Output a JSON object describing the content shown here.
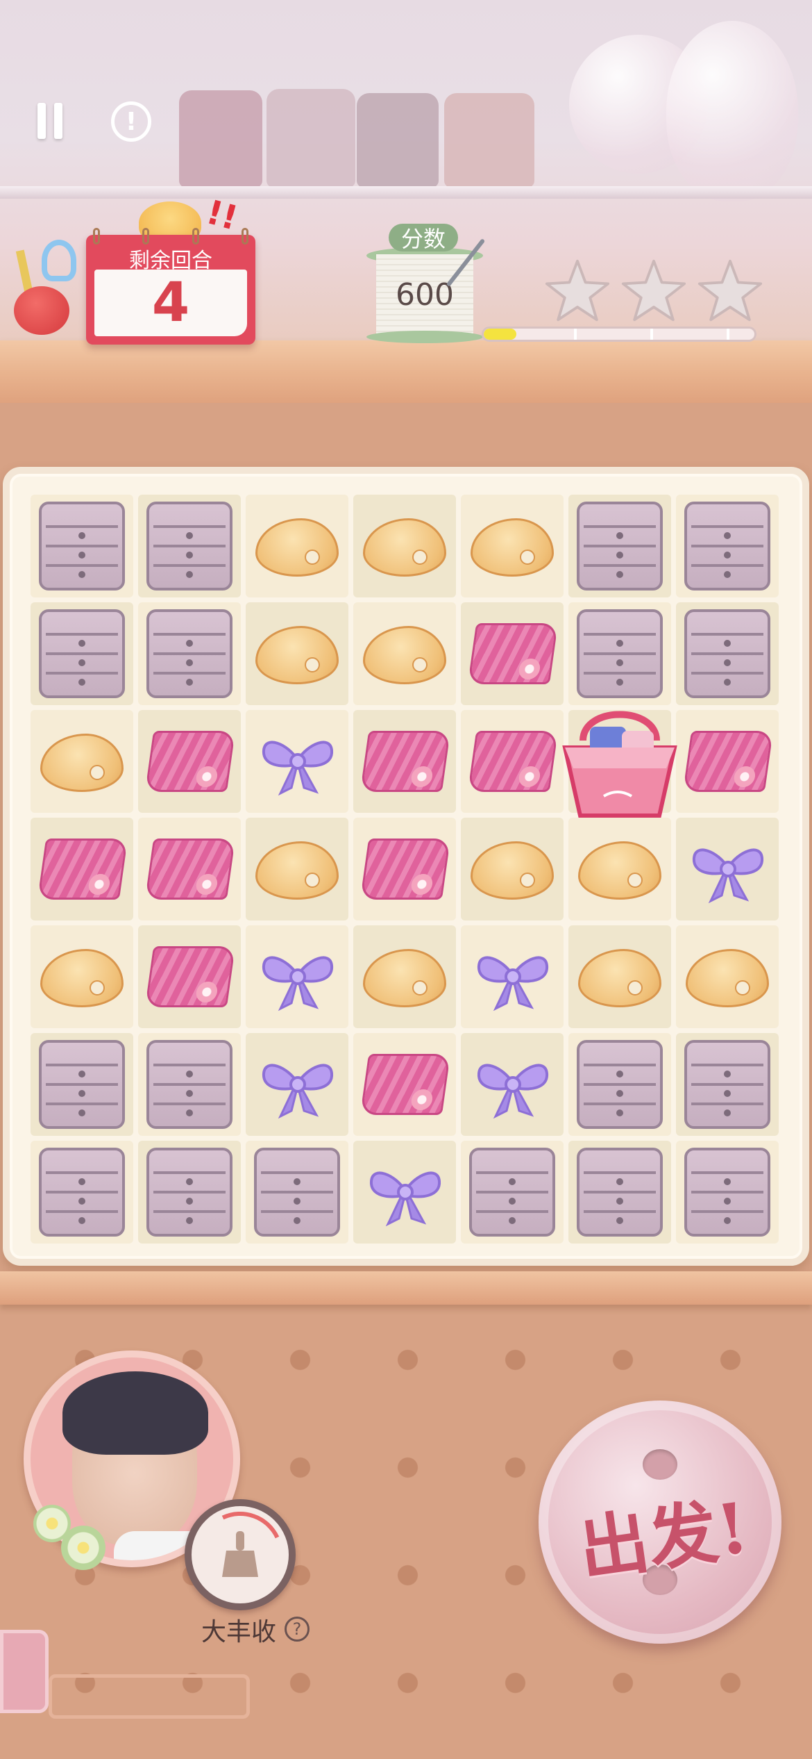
{
  "hud": {
    "turns_label": "剩余回合",
    "turns_value": "4",
    "score_label": "分数",
    "score_value": "600",
    "score_progress": 0.12,
    "stars_earned": 0,
    "stars_total": 3
  },
  "board": {
    "rows": 7,
    "cols": 7,
    "tiles": [
      [
        "drawer",
        "drawer",
        "palette",
        "palette",
        "palette",
        "drawer",
        "drawer"
      ],
      [
        "drawer",
        "drawer",
        "palette",
        "palette",
        "cloth",
        "drawer",
        "drawer"
      ],
      [
        "palette",
        "cloth",
        "bow",
        "cloth",
        "cloth",
        "basket",
        "cloth"
      ],
      [
        "cloth",
        "cloth",
        "palette",
        "cloth",
        "palette",
        "palette",
        "bow"
      ],
      [
        "palette",
        "cloth",
        "bow",
        "palette",
        "bow",
        "palette",
        "palette"
      ],
      [
        "drawer",
        "drawer",
        "bow",
        "cloth",
        "bow",
        "drawer",
        "drawer"
      ],
      [
        "drawer",
        "drawer",
        "drawer",
        "bow",
        "drawer",
        "drawer",
        "drawer"
      ]
    ]
  },
  "skill": {
    "name": "大丰收",
    "help": "?"
  },
  "go_button": {
    "label": "出发!"
  },
  "colors": {
    "accent_red": "#e24a5d",
    "progress_yellow": "#f4e33f",
    "go_text": "#c7526a"
  }
}
